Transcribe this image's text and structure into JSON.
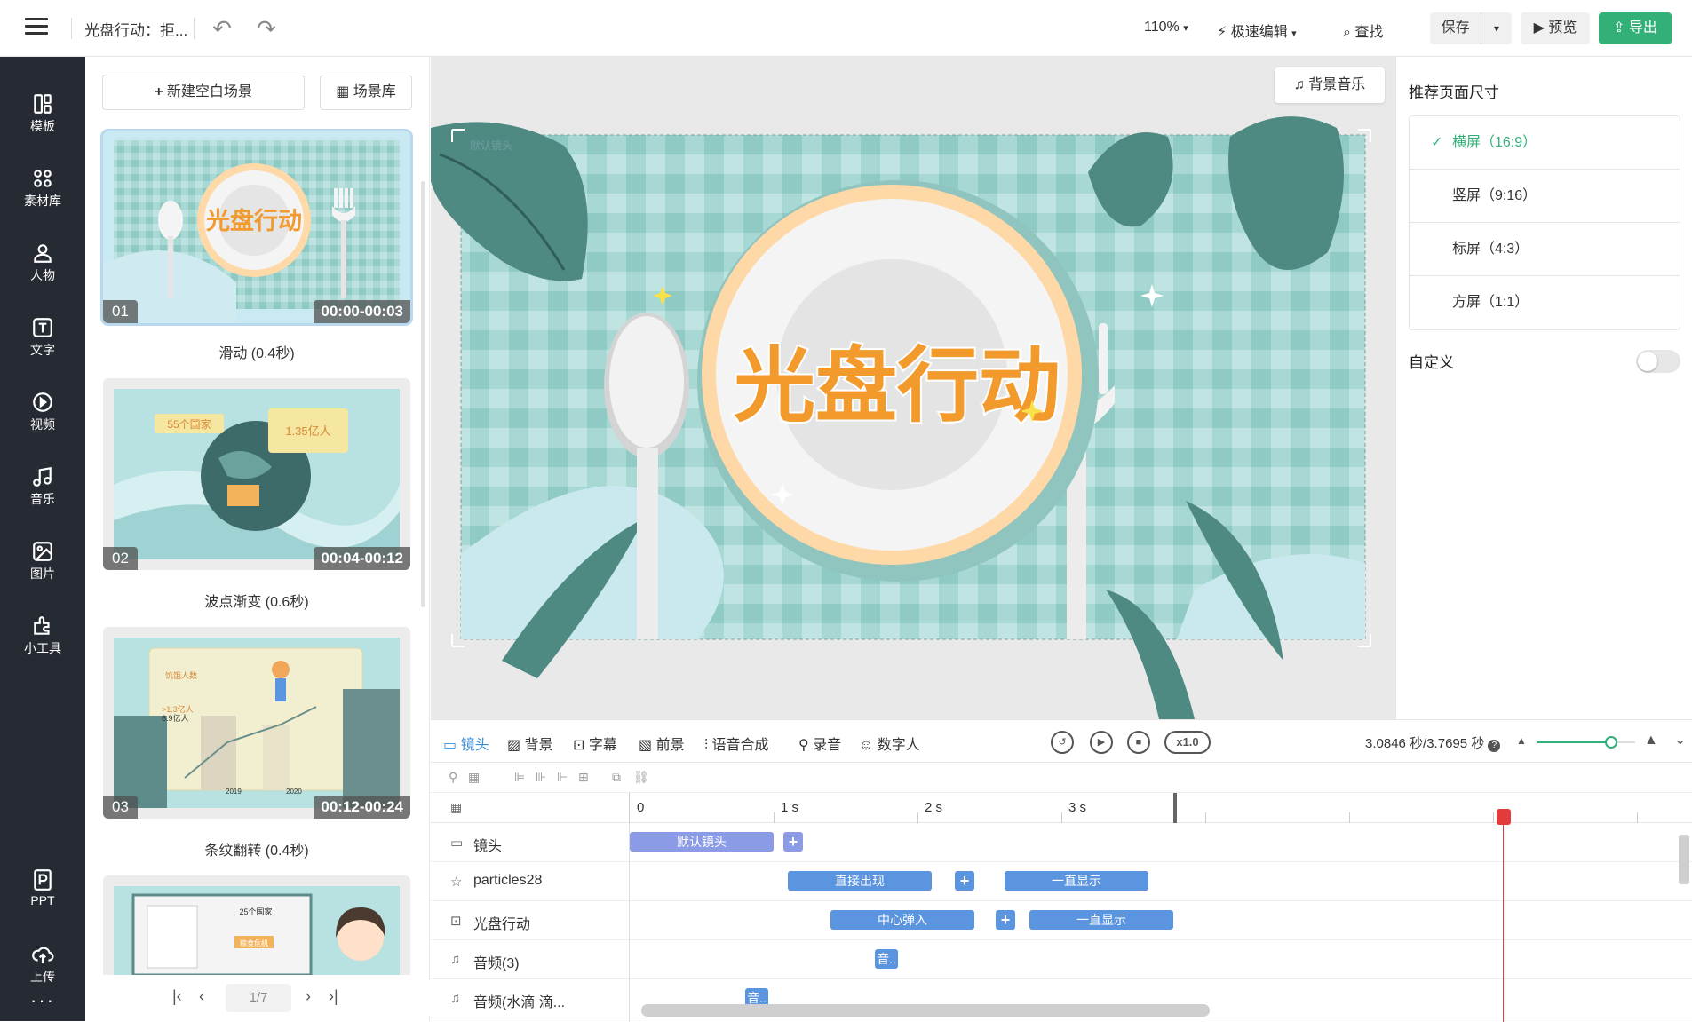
{
  "topbar": {
    "doc_title": "光盘行动：拒...",
    "zoom": "110%",
    "fast_edit": "极速编辑",
    "find": "查找",
    "save": "保存",
    "preview": "预览",
    "export": "导出"
  },
  "leftnav": {
    "items": [
      {
        "label": "模板",
        "icon": "template-icon"
      },
      {
        "label": "素材库",
        "icon": "material-icon"
      },
      {
        "label": "人物",
        "icon": "person-icon"
      },
      {
        "label": "文字",
        "icon": "text-icon"
      },
      {
        "label": "视频",
        "icon": "video-icon"
      },
      {
        "label": "音乐",
        "icon": "music-icon"
      },
      {
        "label": "图片",
        "icon": "image-icon"
      },
      {
        "label": "小工具",
        "icon": "tools-icon"
      }
    ],
    "ppt": "PPT",
    "upload": "上传",
    "more": "···"
  },
  "scenes": {
    "new_blank": "新建空白场景",
    "library": "场景库",
    "list": [
      {
        "num": "01",
        "time": "00:00-00:03",
        "transition": "滑动 (0.4秒)"
      },
      {
        "num": "02",
        "time": "00:04-00:12",
        "transition": "波点渐变 (0.6秒)"
      },
      {
        "num": "03",
        "time": "00:12-00:24",
        "transition": "条纹翻转 (0.4秒)"
      }
    ],
    "scene2_tag1": "55个国家",
    "scene2_tag2": "1.35亿人",
    "scene3_label1": "饥饿人数",
    "scene3_label2": ">1.3亿人",
    "scene3_label3": "6.9亿人",
    "scene3_year1": "2019",
    "scene3_year2": "2020",
    "scene4_label": "25个国家",
    "scene4_tag": "粮食危机",
    "page": "1/7"
  },
  "canvas": {
    "bg_music": "背景音乐",
    "main_text": "光盘行动",
    "camera_tag": "默认镜头"
  },
  "rightpanel": {
    "title": "推荐页面尺寸",
    "sizes": [
      {
        "label": "横屏（16:9）",
        "selected": true
      },
      {
        "label": "竖屏（9:16）",
        "selected": false
      },
      {
        "label": "标屏（4:3）",
        "selected": false
      },
      {
        "label": "方屏（1:1）",
        "selected": false
      }
    ],
    "custom": "自定义"
  },
  "timeline": {
    "tabs": [
      "镜头",
      "背景",
      "字幕",
      "前景",
      "语音合成",
      "录音",
      "数字人"
    ],
    "speed": "x1.0",
    "time": "3.0846 秒/3.7695 秒",
    "zoom_level": 0.75,
    "ruler": [
      "0",
      "1 s",
      "2 s",
      "3 s"
    ],
    "tracks": [
      {
        "label": "镜头",
        "icon": "camera-icon"
      },
      {
        "label": "particles28",
        "icon": "particles-icon"
      },
      {
        "label": "光盘行动",
        "icon": "text-track-icon"
      },
      {
        "label": "音频(3)",
        "icon": "audio-icon"
      },
      {
        "label": "音频(水滴 滴...",
        "icon": "audio-icon"
      }
    ],
    "clips": {
      "camera": "默认镜头",
      "p_enter": "直接出现",
      "p_stay": "一直显示",
      "t_enter": "中心弹入",
      "t_stay": "一直显示",
      "audio3": "音..",
      "audio_drop": "音.."
    }
  }
}
